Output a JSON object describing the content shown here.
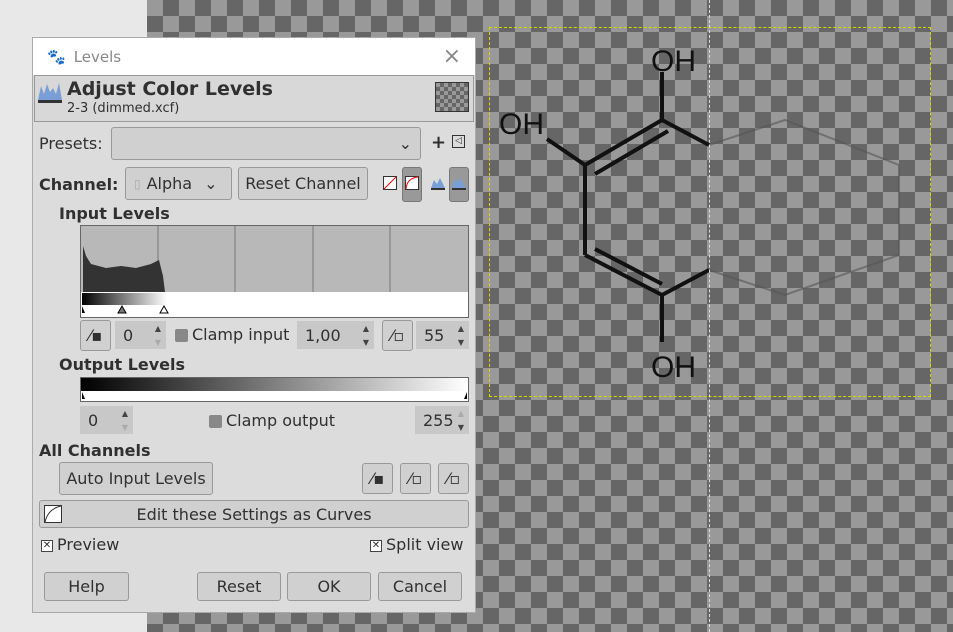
{
  "window": {
    "title": "Levels",
    "close": "×"
  },
  "header": {
    "title": "Adjust Color Levels",
    "subtitle": "2-3 (dimmed.xcf)"
  },
  "presets": {
    "label": "Presets:",
    "value": "",
    "add": "+",
    "menu": "◁"
  },
  "channel": {
    "label": "Channel:",
    "value": "Alpha",
    "reset": "Reset Channel"
  },
  "input_levels": {
    "label": "Input Levels",
    "low": "0",
    "gamma": "1,00",
    "high": "55",
    "clamp_label": "Clamp input",
    "clamp_checked": false
  },
  "output_levels": {
    "label": "Output Levels",
    "low": "0",
    "high": "255",
    "clamp_label": "Clamp output",
    "clamp_checked": false
  },
  "all_channels": {
    "label": "All Channels",
    "auto": "Auto Input Levels"
  },
  "curves_button": "Edit these Settings as Curves",
  "preview": {
    "label": "Preview",
    "checked": true
  },
  "split_view": {
    "label": "Split view",
    "checked": true
  },
  "buttons": {
    "help": "Help",
    "reset": "Reset",
    "ok": "OK",
    "cancel": "Cancel"
  },
  "canvas": {
    "labels": [
      "OH",
      "OH",
      "OH"
    ]
  }
}
